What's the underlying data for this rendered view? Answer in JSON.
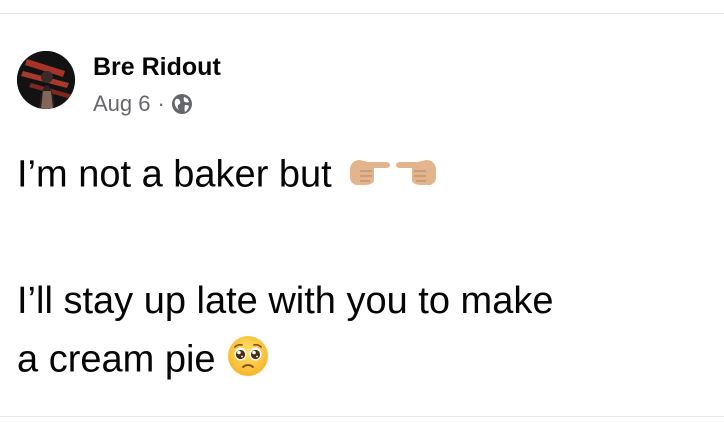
{
  "post": {
    "author_name": "Bre Ridout",
    "date": "Aug 6",
    "separator": "·",
    "audience_icon": "globe-icon",
    "avatar_icon": "profile-photo",
    "body_lines": [
      "I’m not a baker but",
      "I’ll stay up late with you to make",
      "a cream pie"
    ],
    "emojis": [
      "pointing-fingers-emoji",
      "pleading-face-emoji"
    ]
  }
}
